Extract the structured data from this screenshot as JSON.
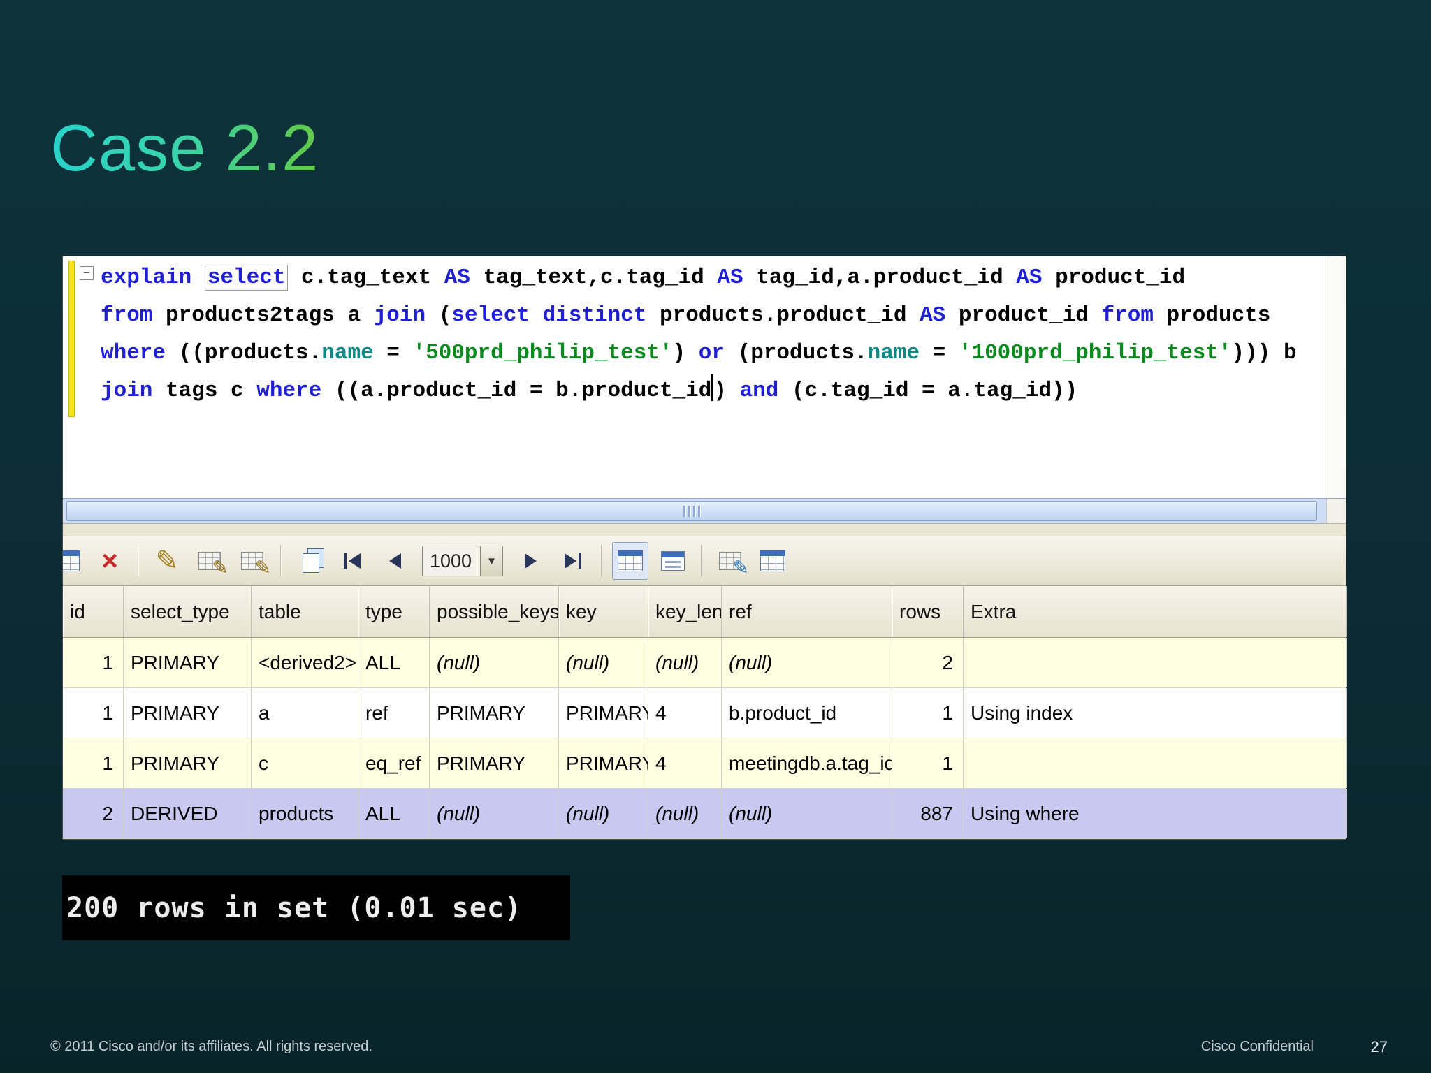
{
  "colors": {
    "slide_background": "#0b2c33",
    "title_gradient_start": "#28d3cb",
    "title_gradient_end": "#63c947",
    "sql_keyword": "#1f1fd6",
    "sql_string": "#0a8a1e",
    "sql_identifier": "#0b8a86",
    "row_stripe": "#ffffe1",
    "row_selected": "#c8c8f0",
    "toolbar_background": "#ece8d8"
  },
  "slide": {
    "title": "Case 2.2",
    "footer_copyright": "© 2011 Cisco and/or its affiliates. All rights reserved.",
    "footer_confidential": "Cisco Confidential",
    "page_number": "27"
  },
  "sql_editor": {
    "fold_marker": "−",
    "lines": [
      [
        {
          "t": "k",
          "s": "explain "
        },
        {
          "t": "kb",
          "s": "select"
        },
        {
          "t": "p",
          "s": " c.tag_text "
        },
        {
          "t": "k",
          "s": "AS"
        },
        {
          "t": "p",
          "s": " tag_text,c.tag_id "
        },
        {
          "t": "k",
          "s": "AS"
        },
        {
          "t": "p",
          "s": " tag_id,a.product_id "
        },
        {
          "t": "k",
          "s": "AS"
        },
        {
          "t": "p",
          "s": " product_id"
        }
      ],
      [
        {
          "t": "k",
          "s": "from"
        },
        {
          "t": "p",
          "s": " products2tags a "
        },
        {
          "t": "k",
          "s": "join"
        },
        {
          "t": "p",
          "s": " ("
        },
        {
          "t": "k",
          "s": "select"
        },
        {
          "t": "p",
          "s": " "
        },
        {
          "t": "k",
          "s": "distinct"
        },
        {
          "t": "p",
          "s": " products.product_id "
        },
        {
          "t": "k",
          "s": "AS"
        },
        {
          "t": "p",
          "s": " product_id "
        },
        {
          "t": "k",
          "s": "from"
        },
        {
          "t": "p",
          "s": " products"
        }
      ],
      [
        {
          "t": "k",
          "s": "where"
        },
        {
          "t": "p",
          "s": " ((products."
        },
        {
          "t": "n",
          "s": "name"
        },
        {
          "t": "p",
          "s": " = "
        },
        {
          "t": "str",
          "s": "'500prd_philip_test'"
        },
        {
          "t": "p",
          "s": ") "
        },
        {
          "t": "k",
          "s": "or"
        },
        {
          "t": "p",
          "s": " (products."
        },
        {
          "t": "n",
          "s": "name"
        },
        {
          "t": "p",
          "s": " = "
        },
        {
          "t": "str",
          "s": "'1000prd_philip_test'"
        },
        {
          "t": "p",
          "s": "))) b"
        }
      ],
      [
        {
          "t": "k",
          "s": "join"
        },
        {
          "t": "p",
          "s": " tags c "
        },
        {
          "t": "k",
          "s": "where"
        },
        {
          "t": "p",
          "s": " ((a.product_id = b.product_id"
        },
        {
          "t": "caret",
          "s": ""
        },
        {
          "t": "p",
          "s": ") "
        },
        {
          "t": "k",
          "s": "and"
        },
        {
          "t": "p",
          "s": " (c.tag_id = a.tag_id))"
        }
      ]
    ]
  },
  "results_toolbar": {
    "page_size": "1000",
    "buttons": [
      {
        "name": "add-record-icon",
        "kind": "grid",
        "accent": "blue",
        "clipped": true
      },
      {
        "name": "delete-record-icon",
        "kind": "x"
      },
      {
        "name": "toolbar-separator",
        "kind": "sep"
      },
      {
        "name": "edit-record-icon",
        "kind": "pencil"
      },
      {
        "name": "apply-changes-icon",
        "kind": "grid-pencil"
      },
      {
        "name": "discard-changes-icon",
        "kind": "grid-pencil"
      },
      {
        "name": "toolbar-separator",
        "kind": "sep"
      },
      {
        "name": "copy-rows-icon",
        "kind": "copy"
      },
      {
        "name": "first-page-icon",
        "kind": "nav",
        "dir": "first"
      },
      {
        "name": "previous-page-icon",
        "kind": "nav",
        "dir": "prev"
      },
      {
        "name": "page-size-dropdown",
        "kind": "dropdown"
      },
      {
        "name": "next-page-icon",
        "kind": "nav",
        "dir": "next"
      },
      {
        "name": "last-page-icon",
        "kind": "nav",
        "dir": "last"
      },
      {
        "name": "toolbar-separator",
        "kind": "sep"
      },
      {
        "name": "grid-view-icon",
        "kind": "grid",
        "accent": "blue",
        "active": true
      },
      {
        "name": "form-view-icon",
        "kind": "form"
      },
      {
        "name": "toolbar-separator",
        "kind": "sep"
      },
      {
        "name": "filter-grid-icon",
        "kind": "grid-pencil",
        "accent": "color"
      },
      {
        "name": "export-grid-icon",
        "kind": "grid",
        "accent": "blue"
      }
    ]
  },
  "results_table": {
    "columns": [
      "id",
      "select_type",
      "table",
      "type",
      "possible_keys",
      "key",
      "key_len",
      "ref",
      "rows",
      "Extra"
    ],
    "rows": [
      {
        "cells": [
          "1",
          "PRIMARY",
          "<derived2>",
          "ALL",
          "(null)",
          "(null)",
          "(null)",
          "(null)",
          "2",
          ""
        ],
        "selected": false
      },
      {
        "cells": [
          "1",
          "PRIMARY",
          "a",
          "ref",
          "PRIMARY",
          "PRIMARY",
          "4",
          "b.product_id",
          "1",
          "Using index"
        ],
        "selected": false
      },
      {
        "cells": [
          "1",
          "PRIMARY",
          "c",
          "eq_ref",
          "PRIMARY",
          "PRIMARY",
          "4",
          "meetingdb.a.tag_id",
          "1",
          ""
        ],
        "selected": false
      },
      {
        "cells": [
          "2",
          "DERIVED",
          "products",
          "ALL",
          "(null)",
          "(null)",
          "(null)",
          "(null)",
          "887",
          "Using where"
        ],
        "selected": true
      }
    ]
  },
  "terminal": {
    "text": "200 rows in set (0.01 sec)"
  }
}
